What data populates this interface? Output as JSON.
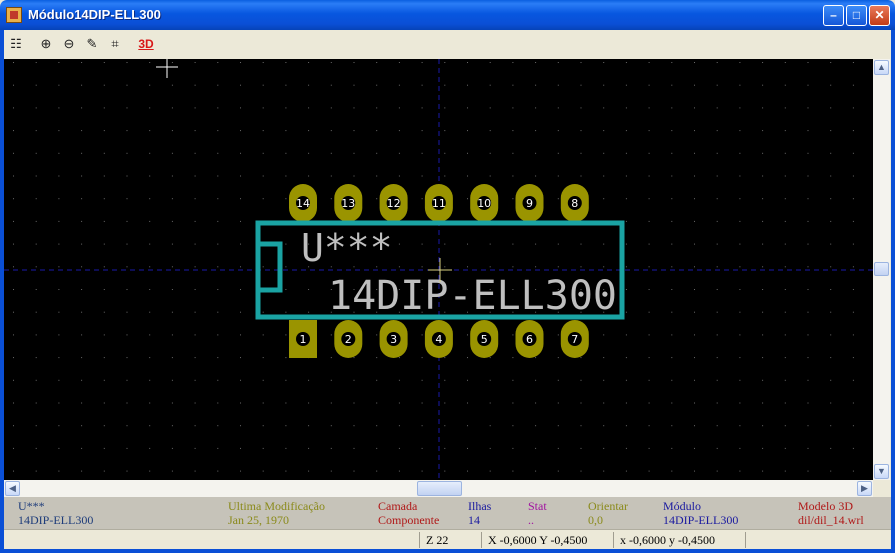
{
  "window": {
    "title": "Módulo14DIP-ELL300",
    "controls": {
      "minimize_glyph": "–",
      "maximize_glyph": "□",
      "close_glyph": "✕"
    }
  },
  "toolbar": {
    "items": [
      {
        "name": "module-icon",
        "glyph": "☷"
      },
      {
        "name": "zoom-in-icon",
        "glyph": "⊕"
      },
      {
        "name": "zoom-out-icon",
        "glyph": "⊖"
      },
      {
        "name": "redraw-icon",
        "glyph": "✎"
      },
      {
        "name": "zoom-fit-icon",
        "glyph": "⌗"
      }
    ],
    "view3d_label": "3D"
  },
  "canvas": {
    "reference": "U***",
    "value": "14DIP-ELL300",
    "pads_top": [
      "14",
      "13",
      "12",
      "11",
      "10",
      "9",
      "8"
    ],
    "pads_bottom": [
      "1",
      "2",
      "3",
      "4",
      "5",
      "6",
      "7"
    ],
    "colors": {
      "background": "#000000",
      "outline": "#1aa3a3",
      "pad": "#9a9400",
      "text": "#bfbfbf",
      "grid": "#6a6a6a",
      "axis": "#1a1aa8",
      "cursor": "#d8d080"
    }
  },
  "info": {
    "reference": {
      "title": "U***",
      "value": "14DIP-ELL300",
      "color": "#1e3c7a"
    },
    "last_modified": {
      "title": "Ultima Modificação",
      "value": "Jan 25, 1970",
      "color": "#8a8a1a"
    },
    "layer": {
      "title": "Camada",
      "value": "Componente",
      "color": "#b01818"
    },
    "pads": {
      "title": "Ilhas",
      "value": "14",
      "color": "#1a1aa0"
    },
    "stat": {
      "title": "Stat",
      "value": "..",
      "color": "#a010a0"
    },
    "orient": {
      "title": "Orientar",
      "value": "0,0",
      "color": "#8a8a1a"
    },
    "module": {
      "title": "Módulo",
      "value": "14DIP-ELL300",
      "color": "#1a1aa0"
    },
    "model3d": {
      "title": "Modelo 3D",
      "value": "dil/dil_14.wrl",
      "color": "#b01818"
    }
  },
  "status": {
    "zoom": "Z 22",
    "abs_coords": "X -0,6000  Y -0,4500",
    "rel_coords": "x -0,6000  y -0,4500"
  }
}
